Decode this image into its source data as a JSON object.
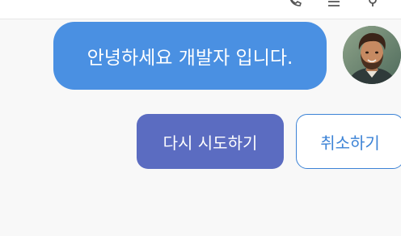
{
  "header": {
    "icons": [
      "phone-icon",
      "menu-icon",
      "settings-icon"
    ]
  },
  "chat": {
    "message": "안녕하세요 개발자 입니다.",
    "avatar_icon": "user-avatar"
  },
  "actions": {
    "retry_label": "다시 시도하기",
    "cancel_label": "취소하기"
  },
  "colors": {
    "bubble": "#4a90e2",
    "retry_button": "#5b6cc1",
    "cancel_border": "#3c83d6",
    "background": "#f8f8f8"
  }
}
